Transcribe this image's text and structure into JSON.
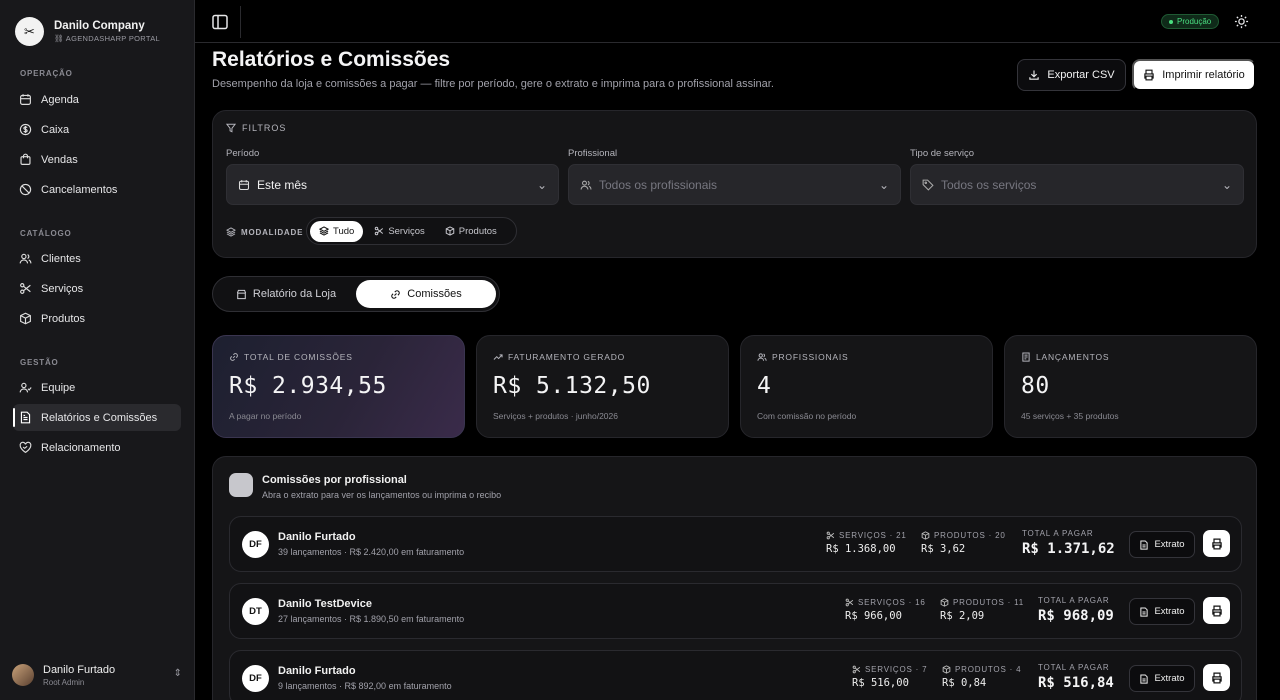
{
  "brand": {
    "name": "Danilo Company",
    "subtitle": "AGENDASHARP PORTAL"
  },
  "sidebar": {
    "groups": [
      {
        "label": "OPERAÇÃO",
        "items": [
          {
            "label": "Agenda",
            "icon": "calendar-icon"
          },
          {
            "label": "Caixa",
            "icon": "dollar-circle-icon"
          },
          {
            "label": "Vendas",
            "icon": "shopping-bag-icon"
          },
          {
            "label": "Cancelamentos",
            "icon": "ban-icon"
          }
        ]
      },
      {
        "label": "CATÁLOGO",
        "items": [
          {
            "label": "Clientes",
            "icon": "users-icon"
          },
          {
            "label": "Serviços",
            "icon": "scissors-icon"
          },
          {
            "label": "Produtos",
            "icon": "package-icon"
          }
        ]
      },
      {
        "label": "GESTÃO",
        "items": [
          {
            "label": "Equipe",
            "icon": "team-icon"
          },
          {
            "label": "Relatórios e Comissões",
            "icon": "report-icon",
            "active": true
          },
          {
            "label": "Relacionamento",
            "icon": "heart-handshake-icon"
          }
        ]
      }
    ],
    "user": {
      "name": "Danilo Furtado",
      "role": "Root Admin"
    }
  },
  "topbar": {
    "env_badge": "Produção"
  },
  "header": {
    "title": "Relatórios e Comissões",
    "subtitle": "Desempenho da loja e comissões a pagar — filtre por período, gere o extrato e imprima para o profissional assinar.",
    "export_label": "Exportar CSV",
    "print_label": "Imprimir relatório"
  },
  "filters": {
    "heading": "FILTROS",
    "period": {
      "label": "Período",
      "value": "Este mês"
    },
    "professional": {
      "label": "Profissional",
      "placeholder": "Todos os profissionais"
    },
    "service_type": {
      "label": "Tipo de serviço",
      "placeholder": "Todos os serviços"
    },
    "modality": {
      "label": "MODALIDADE",
      "options": [
        "Tudo",
        "Serviços",
        "Produtos"
      ],
      "selected": "Tudo"
    }
  },
  "tabs": {
    "store": "Relatório da Loja",
    "commissions": "Comissões",
    "active": "Comissões"
  },
  "kpis": [
    {
      "label": "TOTAL DE COMISSÕES",
      "value": "R$ 2.934,55",
      "note": "A pagar no período",
      "icon": "link-icon"
    },
    {
      "label": "FATURAMENTO GERADO",
      "value": "R$ 5.132,50",
      "note": "Serviços + produtos · junho/2026",
      "icon": "trending-up-icon"
    },
    {
      "label": "PROFISSIONAIS",
      "value": "4",
      "note": "Com comissão no período",
      "icon": "users-icon"
    },
    {
      "label": "LANÇAMENTOS",
      "value": "80",
      "note": "45 serviços + 35 produtos",
      "icon": "receipt-icon"
    }
  ],
  "commissions": {
    "title": "Comissões por profissional",
    "subtitle": "Abra o extrato para ver os lançamentos ou imprima o recibo",
    "extrato_label": "Extrato",
    "total_label": "TOTAL A PAGAR",
    "rows": [
      {
        "initials": "DF",
        "name": "Danilo Furtado",
        "sub": "39 lançamentos · R$ 2.420,00 em faturamento",
        "services_label": "SERVIÇOS · 21",
        "services_value": "R$ 1.368,00",
        "products_label": "PRODUTOS · 20",
        "products_value": "R$ 3,62",
        "total": "R$ 1.371,62"
      },
      {
        "initials": "DT",
        "name": "Danilo TestDevice",
        "sub": "27 lançamentos · R$ 1.890,50 em faturamento",
        "services_label": "SERVIÇOS · 16",
        "services_value": "R$ 966,00",
        "products_label": "PRODUTOS · 11",
        "products_value": "R$ 2,09",
        "total": "R$ 968,09"
      },
      {
        "initials": "DF",
        "name": "Danilo Furtado",
        "sub": "9 lançamentos · R$ 892,00 em faturamento",
        "services_label": "SERVIÇOS · 7",
        "services_value": "R$ 516,00",
        "products_label": "PRODUTOS · 4",
        "products_value": "R$ 0,84",
        "total": "R$ 516,84"
      }
    ]
  }
}
